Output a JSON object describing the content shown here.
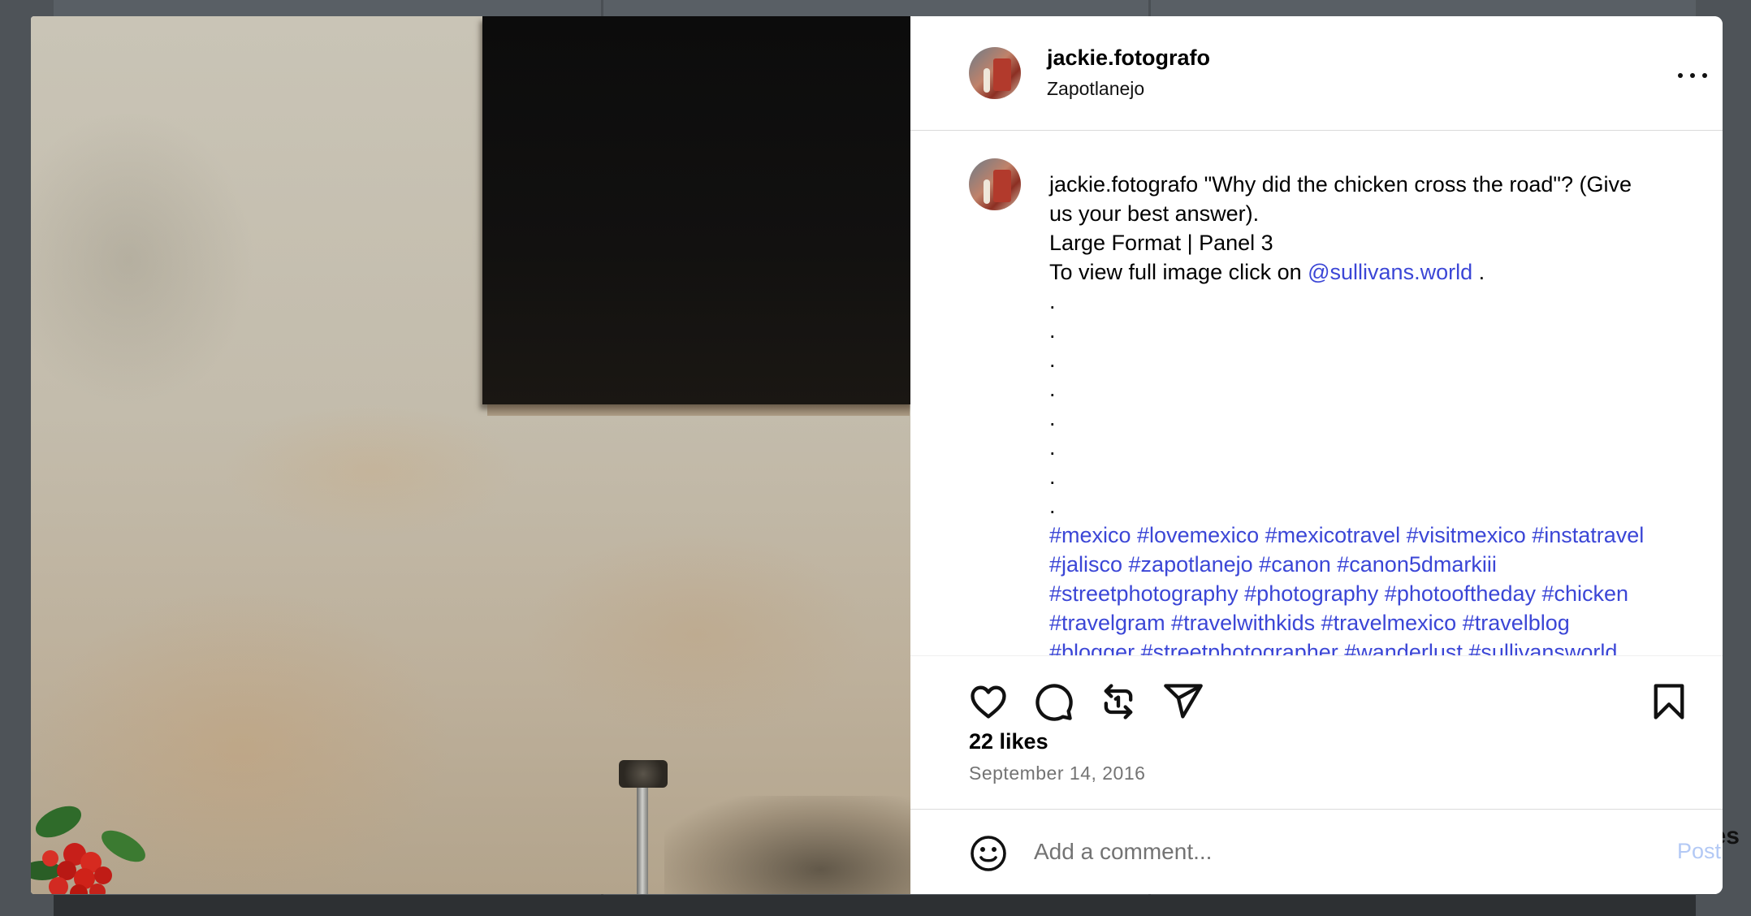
{
  "post": {
    "username": "jackie.fotografo",
    "location": "Zapotlanejo",
    "caption": {
      "username": "jackie.fotografo",
      "line1_text": " \"Why did the chicken cross the road\"? (Give",
      "line2": "us your best answer).",
      "line3": "Large Format | Panel 3",
      "line4_prefix": "To view full image click on ",
      "mention": "@sullivans.world",
      "line4_suffix": " .",
      "dots": [
        ".",
        ".",
        ".",
        ".",
        ".",
        ".",
        ".",
        "."
      ],
      "hashtag_lines": [
        "#mexico #lovemexico #mexicotravel #visitmexico #instatravel",
        "#jalisco #zapotlanejo #canon #canon5dmarkiii",
        "#streetphotography #photography #photooftheday #chicken",
        "#travelgram #travelwithkids #travelmexico #travelblog",
        "#blogger #streetphotographer #wanderlust #sullivansworld"
      ]
    },
    "likes": "22 likes",
    "date": "September 14, 2016"
  },
  "comment": {
    "placeholder": "Add a comment...",
    "post_label": "Post"
  },
  "background": {
    "peek_text": "es"
  },
  "icons": {
    "more": "more-options-icon",
    "like": "heart-icon",
    "comment": "comment-bubble-icon",
    "repost": "repost-icon",
    "share": "paper-plane-icon",
    "save": "bookmark-icon",
    "emoji": "emoji-smile-icon"
  },
  "colors": {
    "link": "#3b46d6",
    "post_button_disabled": "#b3c9f5",
    "muted_text": "#737373"
  }
}
